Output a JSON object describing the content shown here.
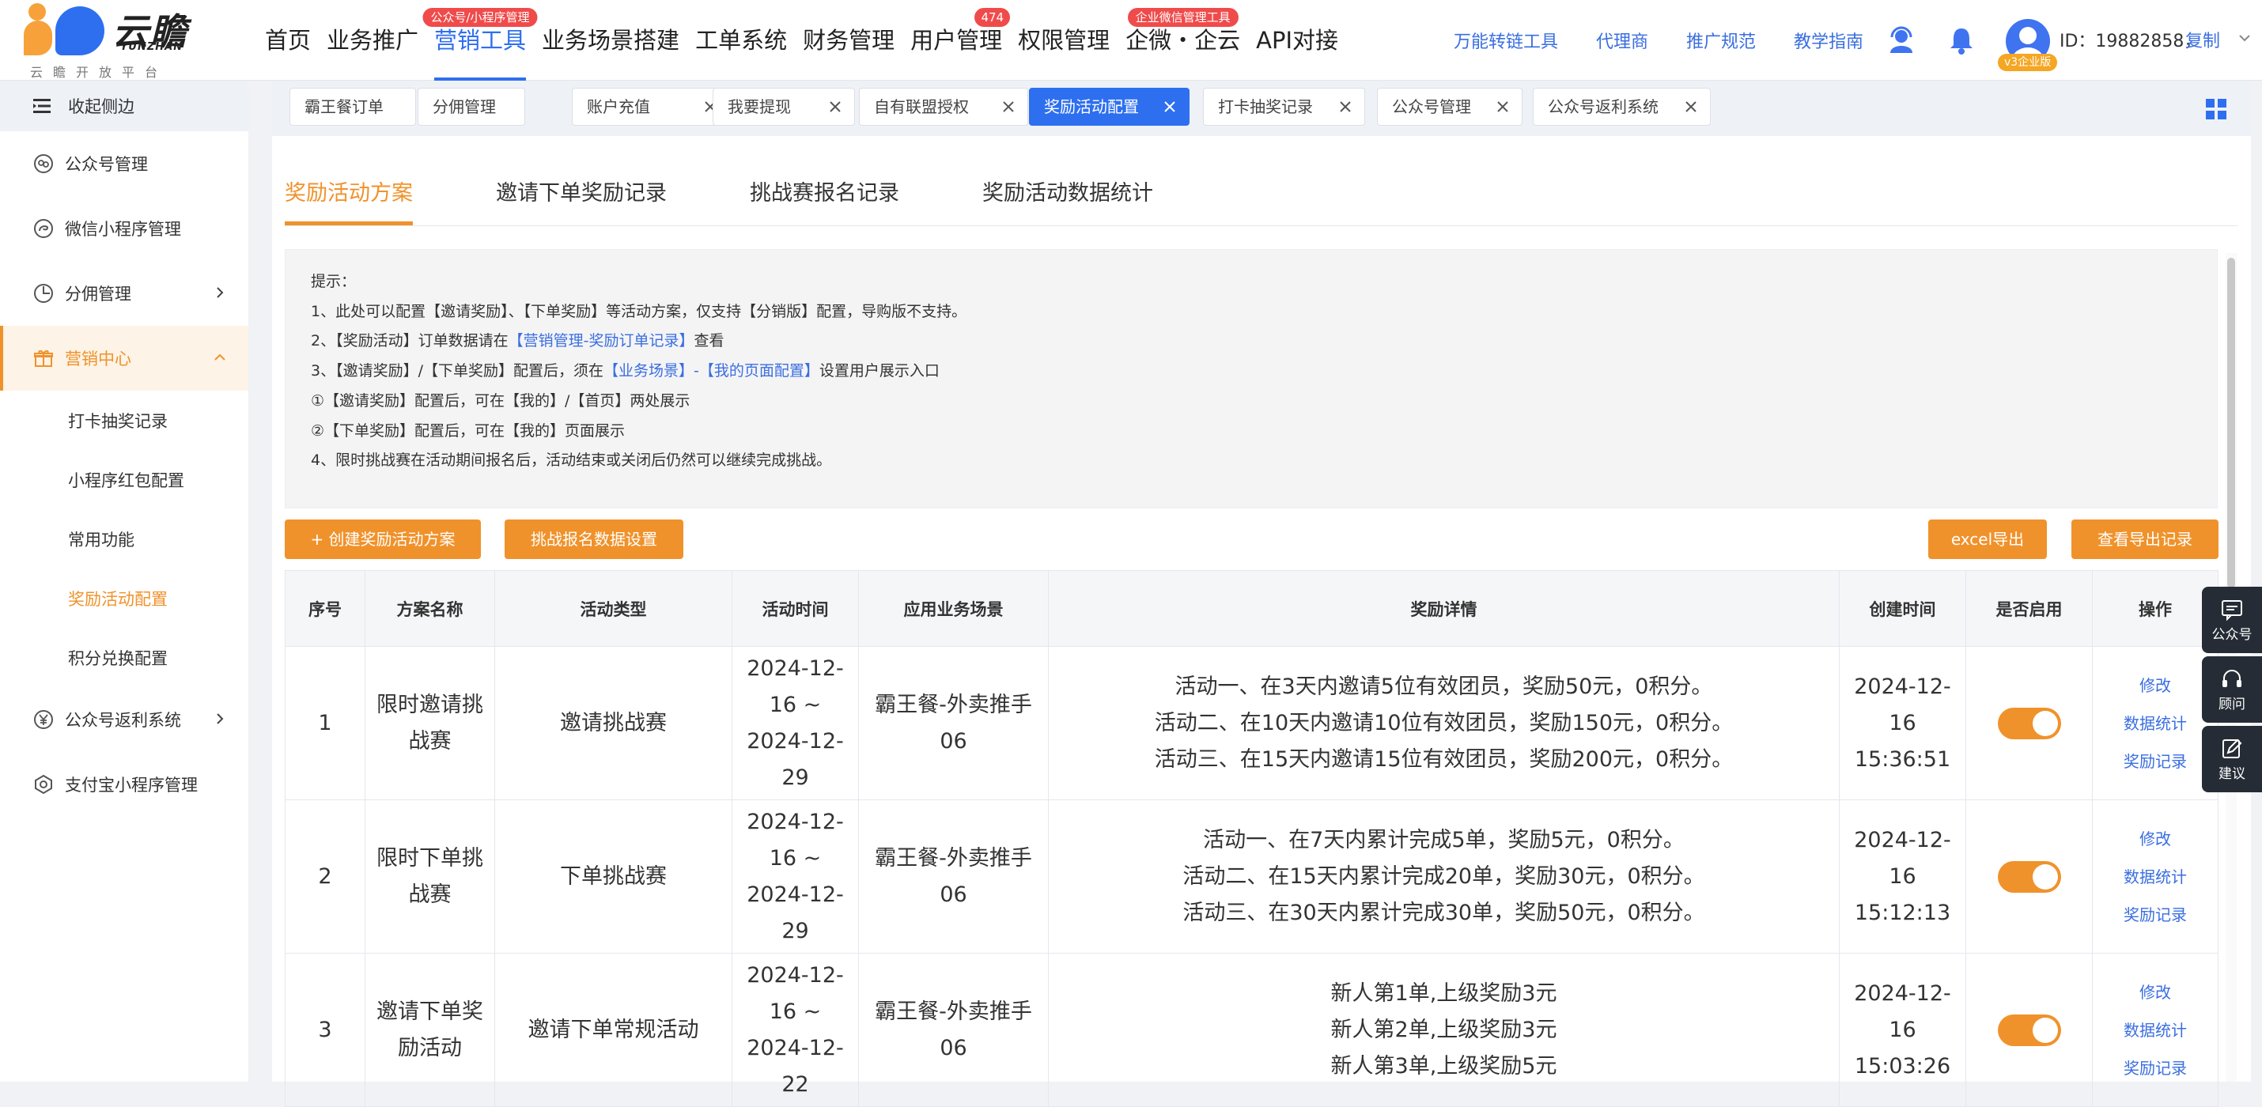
{
  "brand": {
    "name": "云瞻",
    "pinyin": "YUNZHAN",
    "subtitle": "云瞻开放平台"
  },
  "nav": {
    "items": [
      {
        "label": "首页",
        "badge": ""
      },
      {
        "label": "业务推广",
        "badge": ""
      },
      {
        "label": "营销工具",
        "badge": "公众号/小程序管理",
        "active": true
      },
      {
        "label": "业务场景搭建",
        "badge": ""
      },
      {
        "label": "工单系统",
        "badge": ""
      },
      {
        "label": "财务管理",
        "badge": ""
      },
      {
        "label": "用户管理",
        "badge": "474"
      },
      {
        "label": "权限管理",
        "badge": ""
      },
      {
        "label": "企微・企云",
        "badge": "企业微信管理工具"
      },
      {
        "label": "API对接",
        "badge": ""
      }
    ],
    "quick_links": [
      "万能转链工具",
      "代理商",
      "推广规范",
      "教学指南"
    ]
  },
  "user": {
    "id_text": "ID：19882858，",
    "copy_label": "复制",
    "version_badge": "v3企业版"
  },
  "sidebar": {
    "collapse_label": "收起侧边",
    "items": [
      {
        "label": "公众号管理",
        "icon": "wechat-official-icon"
      },
      {
        "label": "微信小程序管理",
        "icon": "mini-program-icon"
      },
      {
        "label": "分佣管理",
        "icon": "commission-icon",
        "expandable": true
      },
      {
        "label": "营销中心",
        "icon": "gift-icon",
        "expanded": true
      },
      {
        "label": "公众号返利系统",
        "icon": "yen-icon",
        "expandable": true
      },
      {
        "label": "支付宝小程序管理",
        "icon": "alipay-icon"
      }
    ],
    "submenu": [
      {
        "label": "打卡抽奖记录"
      },
      {
        "label": "小程序红包配置"
      },
      {
        "label": "常用功能"
      },
      {
        "label": "奖励活动配置",
        "active": true
      },
      {
        "label": "积分兑换配置"
      }
    ]
  },
  "tabs": [
    {
      "label": "霸王餐订单",
      "closable": false
    },
    {
      "label": "分佣管理",
      "closable": false
    },
    {
      "label": "账户充值",
      "closable": true
    },
    {
      "label": "我要提现",
      "closable": true
    },
    {
      "label": "自有联盟授权",
      "closable": true
    },
    {
      "label": "奖励活动配置",
      "closable": true,
      "active": true
    },
    {
      "label": "打卡抽奖记录",
      "closable": true
    },
    {
      "label": "公众号管理",
      "closable": true
    },
    {
      "label": "公众号返利系统",
      "closable": true
    }
  ],
  "sub_tabs": [
    "奖励活动方案",
    "邀请下单奖励记录",
    "挑战赛报名记录",
    "奖励活动数据统计"
  ],
  "tips": {
    "title": "提示：",
    "line1": "1、此处可以配置【邀请奖励】、【下单奖励】等活动方案，仅支持【分销版】配置，导购版不支持。",
    "line2_pre": "2、【奖励活动】订单数据请在",
    "line2_link": "【营销管理-奖励订单记录】",
    "line2_post": "查看",
    "line3_pre": "3、【邀请奖励】/【下单奖励】配置后，须在",
    "line3_link": "【业务场景】-【我的页面配置】",
    "line3_post": "设置用户展示入口",
    "line4": "①【邀请奖励】配置后，可在【我的】/【首页】两处展示",
    "line5": "②【下单奖励】配置后，可在【我的】页面展示",
    "line6": "4、限时挑战赛在活动期间报名后，活动结束或关闭后仍然可以继续完成挑战。"
  },
  "buttons": {
    "create": "+ 创建奖励活动方案",
    "challenge_settings": "挑战报名数据设置",
    "excel_export": "excel导出",
    "export_records": "查看导出记录"
  },
  "table": {
    "headers": [
      "序号",
      "方案名称",
      "活动类型",
      "活动时间",
      "应用业务场景",
      "奖励详情",
      "创建时间",
      "是否启用",
      "操作"
    ],
    "rows": [
      {
        "no": "1",
        "name": "限时邀请挑战赛",
        "type": "邀请挑战赛",
        "time": "2024-12-16 ~ 2024-12-29",
        "scene": "霸王餐-外卖推手06",
        "rewards": [
          "活动一、在3天内邀请5位有效团员，奖励50元，0积分。",
          "活动二、在10天内邀请10位有效团员，奖励150元，0积分。",
          "活动三、在15天内邀请15位有效团员，奖励200元，0积分。"
        ],
        "created": "2024-12-16 15:36:51",
        "enabled": true,
        "ops": [
          "修改",
          "数据统计",
          "奖励记录"
        ]
      },
      {
        "no": "2",
        "name": "限时下单挑战赛",
        "type": "下单挑战赛",
        "time": "2024-12-16 ~ 2024-12-29",
        "scene": "霸王餐-外卖推手06",
        "rewards": [
          "活动一、在7天内累计完成5单，奖励5元，0积分。",
          "活动二、在15天内累计完成20单，奖励30元，0积分。",
          "活动三、在30天内累计完成30单，奖励50元，0积分。"
        ],
        "created": "2024-12-16 15:12:13",
        "enabled": true,
        "ops": [
          "修改",
          "数据统计",
          "奖励记录"
        ]
      },
      {
        "no": "3",
        "name": "邀请下单奖励活动",
        "type": "邀请下单常规活动",
        "time": "2024-12-16 ~ 2024-12-22",
        "scene": "霸王餐-外卖推手06",
        "rewards": [
          "新人第1单,上级奖励3元",
          "新人第2单,上级奖励3元",
          "新人第3单,上级奖励5元"
        ],
        "created": "2024-12-16 15:03:26",
        "enabled": true,
        "ops": [
          "修改",
          "数据统计",
          "奖励记录"
        ]
      }
    ]
  },
  "float_widgets": [
    {
      "label": "公众号",
      "icon": "message-icon"
    },
    {
      "label": "顾问",
      "icon": "headset-icon"
    },
    {
      "label": "建议",
      "icon": "edit-icon"
    }
  ],
  "colors": {
    "primary_blue": "#2e6ff0",
    "accent_orange": "#f0922b",
    "badge_red": "#f04b4b",
    "link_blue": "#3a6ee0"
  }
}
